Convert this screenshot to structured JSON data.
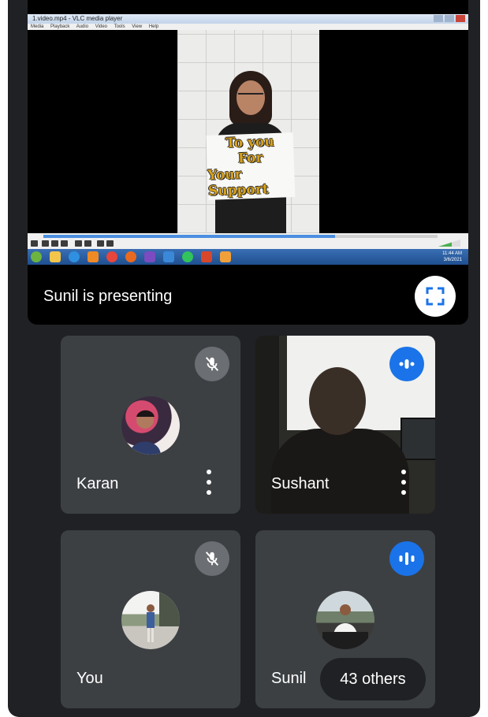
{
  "presentation": {
    "label": "Sunil is presenting",
    "fullscreen_icon": "fullscreen-icon",
    "shared_screen": {
      "window_title": "1.video.mp4 - VLC media player",
      "menu": [
        "Media",
        "Playback",
        "Audio",
        "Video",
        "Tools",
        "View",
        "Help"
      ],
      "sign_lines": [
        "To you",
        "For",
        "Your Support"
      ],
      "clock_time": "11:44 AM",
      "clock_date": "3/6/2021"
    }
  },
  "participants": [
    {
      "name": "Karan",
      "mic": "muted",
      "status_icon": "mic-off-icon",
      "more_icon": "more-vert-icon"
    },
    {
      "name": "Sushant",
      "mic": "speaking",
      "status_icon": "audio-levels-icon",
      "more_icon": "more-vert-icon",
      "video": "on"
    },
    {
      "name": "You",
      "mic": "muted",
      "status_icon": "mic-off-icon"
    },
    {
      "name": "Sunil",
      "mic": "speaking",
      "status_icon": "audio-levels-icon",
      "others_label": "43 others"
    }
  ],
  "colors": {
    "background": "#202124",
    "tile": "#3c4043",
    "speaking_accent": "#1a73e8",
    "muted_badge": "#6b6e72"
  }
}
